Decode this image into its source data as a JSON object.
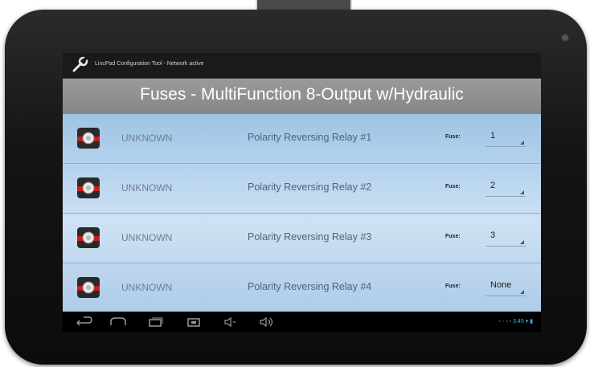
{
  "window": {
    "app_title": "LincPad Configuration Tool - Network active"
  },
  "header": {
    "title": "Fuses - MultiFunction 8-Output w/Hydraulic"
  },
  "rows": [
    {
      "status": "UNKNOWN",
      "description": "Polarity Reversing Relay #1",
      "fuse_label": "Fuse:",
      "fuse_value": "1"
    },
    {
      "status": "UNKNOWN",
      "description": "Polarity Reversing Relay #2",
      "fuse_label": "Fuse:",
      "fuse_value": "2"
    },
    {
      "status": "UNKNOWN",
      "description": "Polarity Reversing Relay #3",
      "fuse_label": "Fuse:",
      "fuse_value": "3"
    },
    {
      "status": "UNKNOWN",
      "description": "Polarity Reversing Relay #4",
      "fuse_label": "Fuse:",
      "fuse_value": "None"
    }
  ],
  "navbar": {
    "icons": [
      "back-icon",
      "home-icon",
      "recent-apps-icon",
      "screenshot-icon",
      "volume-down-icon",
      "volume-up-icon"
    ],
    "clock": "3:45"
  },
  "colors": {
    "header_bg": "#8f8f8f",
    "list_bg": "#b7d4ee",
    "status_accent": "#33b5e5"
  }
}
